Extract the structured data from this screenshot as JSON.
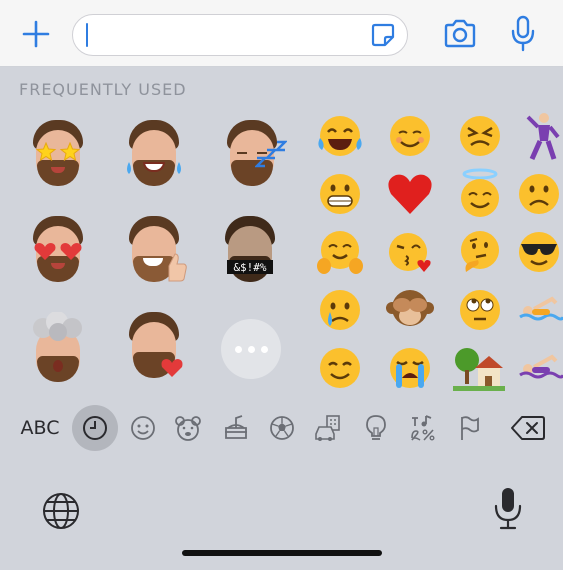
{
  "composer": {
    "placeholder": ""
  },
  "emoji_panel": {
    "section_title": "FREQUENTLY USED"
  },
  "keyboard_toolbar": {
    "abc_label": "ABC",
    "categories": [
      {
        "name": "recent",
        "icon": "clock-icon",
        "selected": true
      },
      {
        "name": "smileys",
        "icon": "smiley-icon",
        "selected": false
      },
      {
        "name": "animals",
        "icon": "bear-icon",
        "selected": false
      },
      {
        "name": "food",
        "icon": "food-icon",
        "selected": false
      },
      {
        "name": "activity",
        "icon": "soccer-ball-icon",
        "selected": false
      },
      {
        "name": "travel",
        "icon": "car-building-icon",
        "selected": false
      },
      {
        "name": "objects",
        "icon": "lightbulb-icon",
        "selected": false
      },
      {
        "name": "symbols",
        "icon": "symbols-icon",
        "selected": false
      },
      {
        "name": "flags",
        "icon": "flag-icon",
        "selected": false
      }
    ]
  },
  "memoji_stickers": [
    {
      "name": "star-eyes"
    },
    {
      "name": "tears-of-joy"
    },
    {
      "name": "sleeping"
    },
    {
      "name": "heart-eyes"
    },
    {
      "name": "thumbs-up"
    },
    {
      "name": "swearing",
      "caption": "&$!#%"
    },
    {
      "name": "mind-blown"
    },
    {
      "name": "kiss"
    }
  ],
  "emoji_grid": {
    "items": [
      "😂",
      "☺️",
      "😣",
      "🕺",
      "😬",
      "❤️",
      "😇",
      "☹️",
      "🤗",
      "😘",
      "🤔",
      "😎",
      "😢",
      "🙈",
      "🙄",
      "🏊",
      "😊",
      "😭",
      "🏡",
      "🏊"
    ]
  },
  "colors": {
    "accent": "#2f7de1",
    "keyboard_bg": "#d1d4db",
    "topbar_bg": "#f6f6f6"
  }
}
